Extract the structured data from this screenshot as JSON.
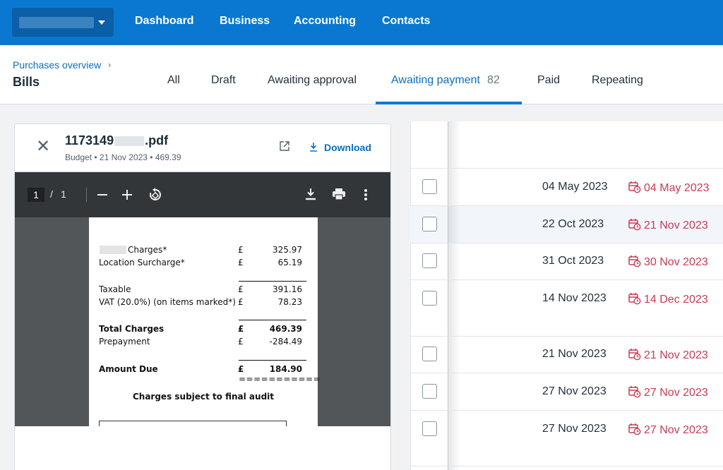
{
  "nav": {
    "items": [
      "Dashboard",
      "Business",
      "Accounting",
      "Contacts"
    ]
  },
  "header": {
    "breadcrumb": "Purchases overview",
    "title": "Bills",
    "tabs": [
      {
        "label": "All"
      },
      {
        "label": "Draft"
      },
      {
        "label": "Awaiting approval"
      },
      {
        "label": "Awaiting payment",
        "count": "82",
        "active": true
      },
      {
        "label": "Paid"
      },
      {
        "label": "Repeating"
      }
    ]
  },
  "viewer": {
    "filename_prefix": "1173149",
    "filename_suffix": ".pdf",
    "meta": "Budget • 21 Nov 2023 • 469.39",
    "download_label": "Download",
    "page_current": "1",
    "page_sep": "/",
    "page_total": "1",
    "doc": {
      "lines": [
        {
          "label": "Charges*",
          "cur": "£",
          "amount": "325.97"
        },
        {
          "label": "Location Surcharge*",
          "cur": "£",
          "amount": "65.19"
        },
        {
          "label": "Taxable",
          "cur": "£",
          "amount": "391.16"
        },
        {
          "label": "VAT (20.0%) (on items marked*)",
          "cur": "£",
          "amount": "78.23"
        },
        {
          "label": "Total Charges",
          "cur": "£",
          "amount": "469.39"
        },
        {
          "label": "Prepayment",
          "cur": "£",
          "amount": "-284.49"
        },
        {
          "label": "Amount Due",
          "cur": "£",
          "amount": "184.90"
        }
      ],
      "double_rule": "===========",
      "footer_note": "Charges subject to final audit"
    }
  },
  "bills": [
    {
      "date": "04 May 2023",
      "due": "04 May 2023"
    },
    {
      "date": "22 Oct 2023",
      "due": "21 Nov 2023"
    },
    {
      "date": "31 Oct 2023",
      "due": "30 Nov 2023"
    },
    {
      "date": "14 Nov 2023",
      "due": "14 Dec 2023"
    },
    {
      "date": "21 Nov 2023",
      "due": "21 Nov 2023"
    },
    {
      "date": "27 Nov 2023",
      "due": "27 Nov 2023"
    },
    {
      "date": "27 Nov 2023",
      "due": "27 Nov 2023"
    }
  ],
  "colors": {
    "nav_bg": "#0a78d1",
    "link_blue": "#0a6ebd",
    "overdue_red": "#c93a55"
  },
  "icons": [
    "caret-down-icon",
    "chevron-right-icon",
    "close-icon",
    "external-link-icon",
    "download-icon",
    "zoom-out-icon",
    "zoom-in-icon",
    "rotate-icon",
    "print-icon",
    "more-vertical-icon",
    "calendar-clock-icon",
    "checkbox-icon"
  ]
}
